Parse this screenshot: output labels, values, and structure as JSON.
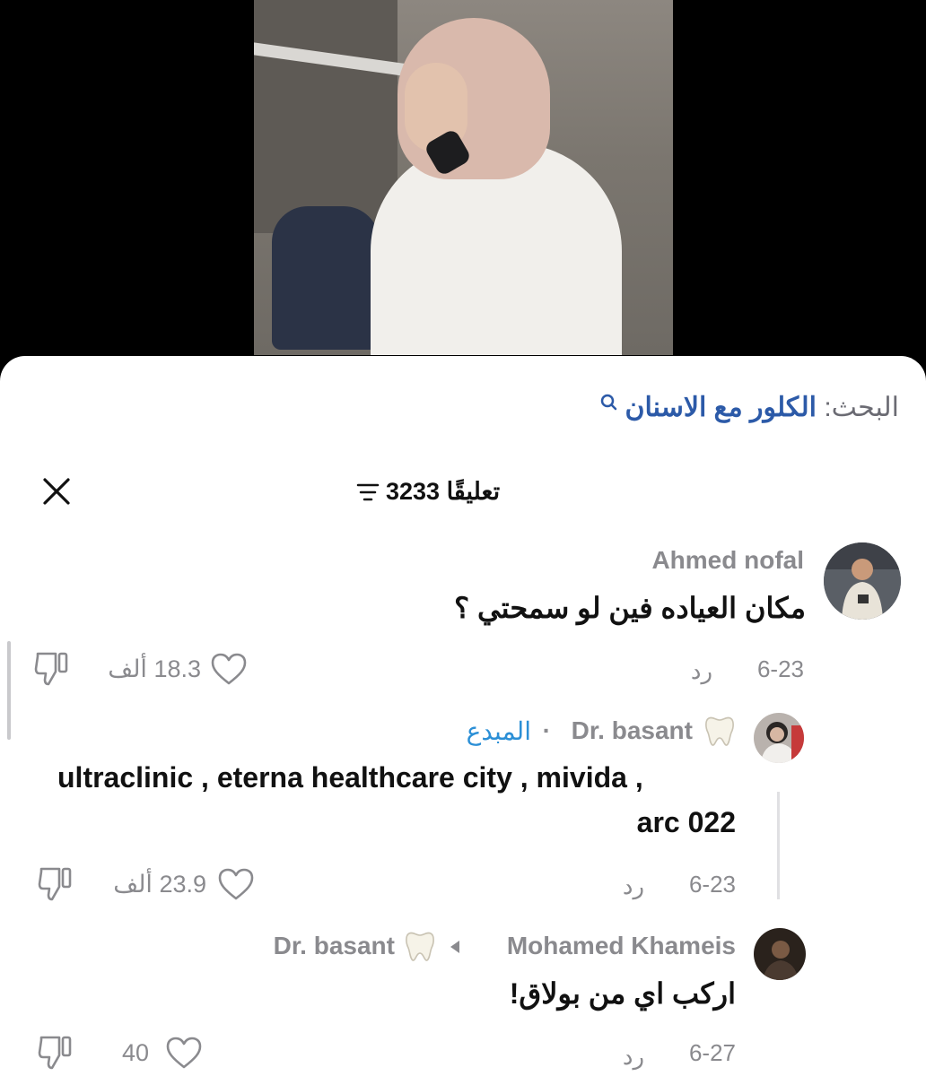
{
  "search": {
    "prefix": "البحث:",
    "query": "الكلور مع الاسنان"
  },
  "header": {
    "count_label": "3233 تعليقًا"
  },
  "comments": [
    {
      "author": "Ahmed nofal",
      "text": "مكان العياده فين لو سمحتي ؟",
      "date": "6-23",
      "reply_label": "رد",
      "likes": "18.3 ألف"
    },
    {
      "author": "Dr. basant",
      "badge": "المبدع",
      "text_line1": "ultraclinic , eterna healthcare city , mivida ,",
      "text_line2": "arc 022",
      "date": "6-23",
      "reply_label": "رد",
      "likes": "23.9 ألف"
    },
    {
      "author": "Mohamed Khameis",
      "reply_to": "Dr. basant",
      "text": "اركب اي من بولاق!",
      "date": "6-27",
      "reply_label": "رد",
      "likes": "40"
    }
  ]
}
